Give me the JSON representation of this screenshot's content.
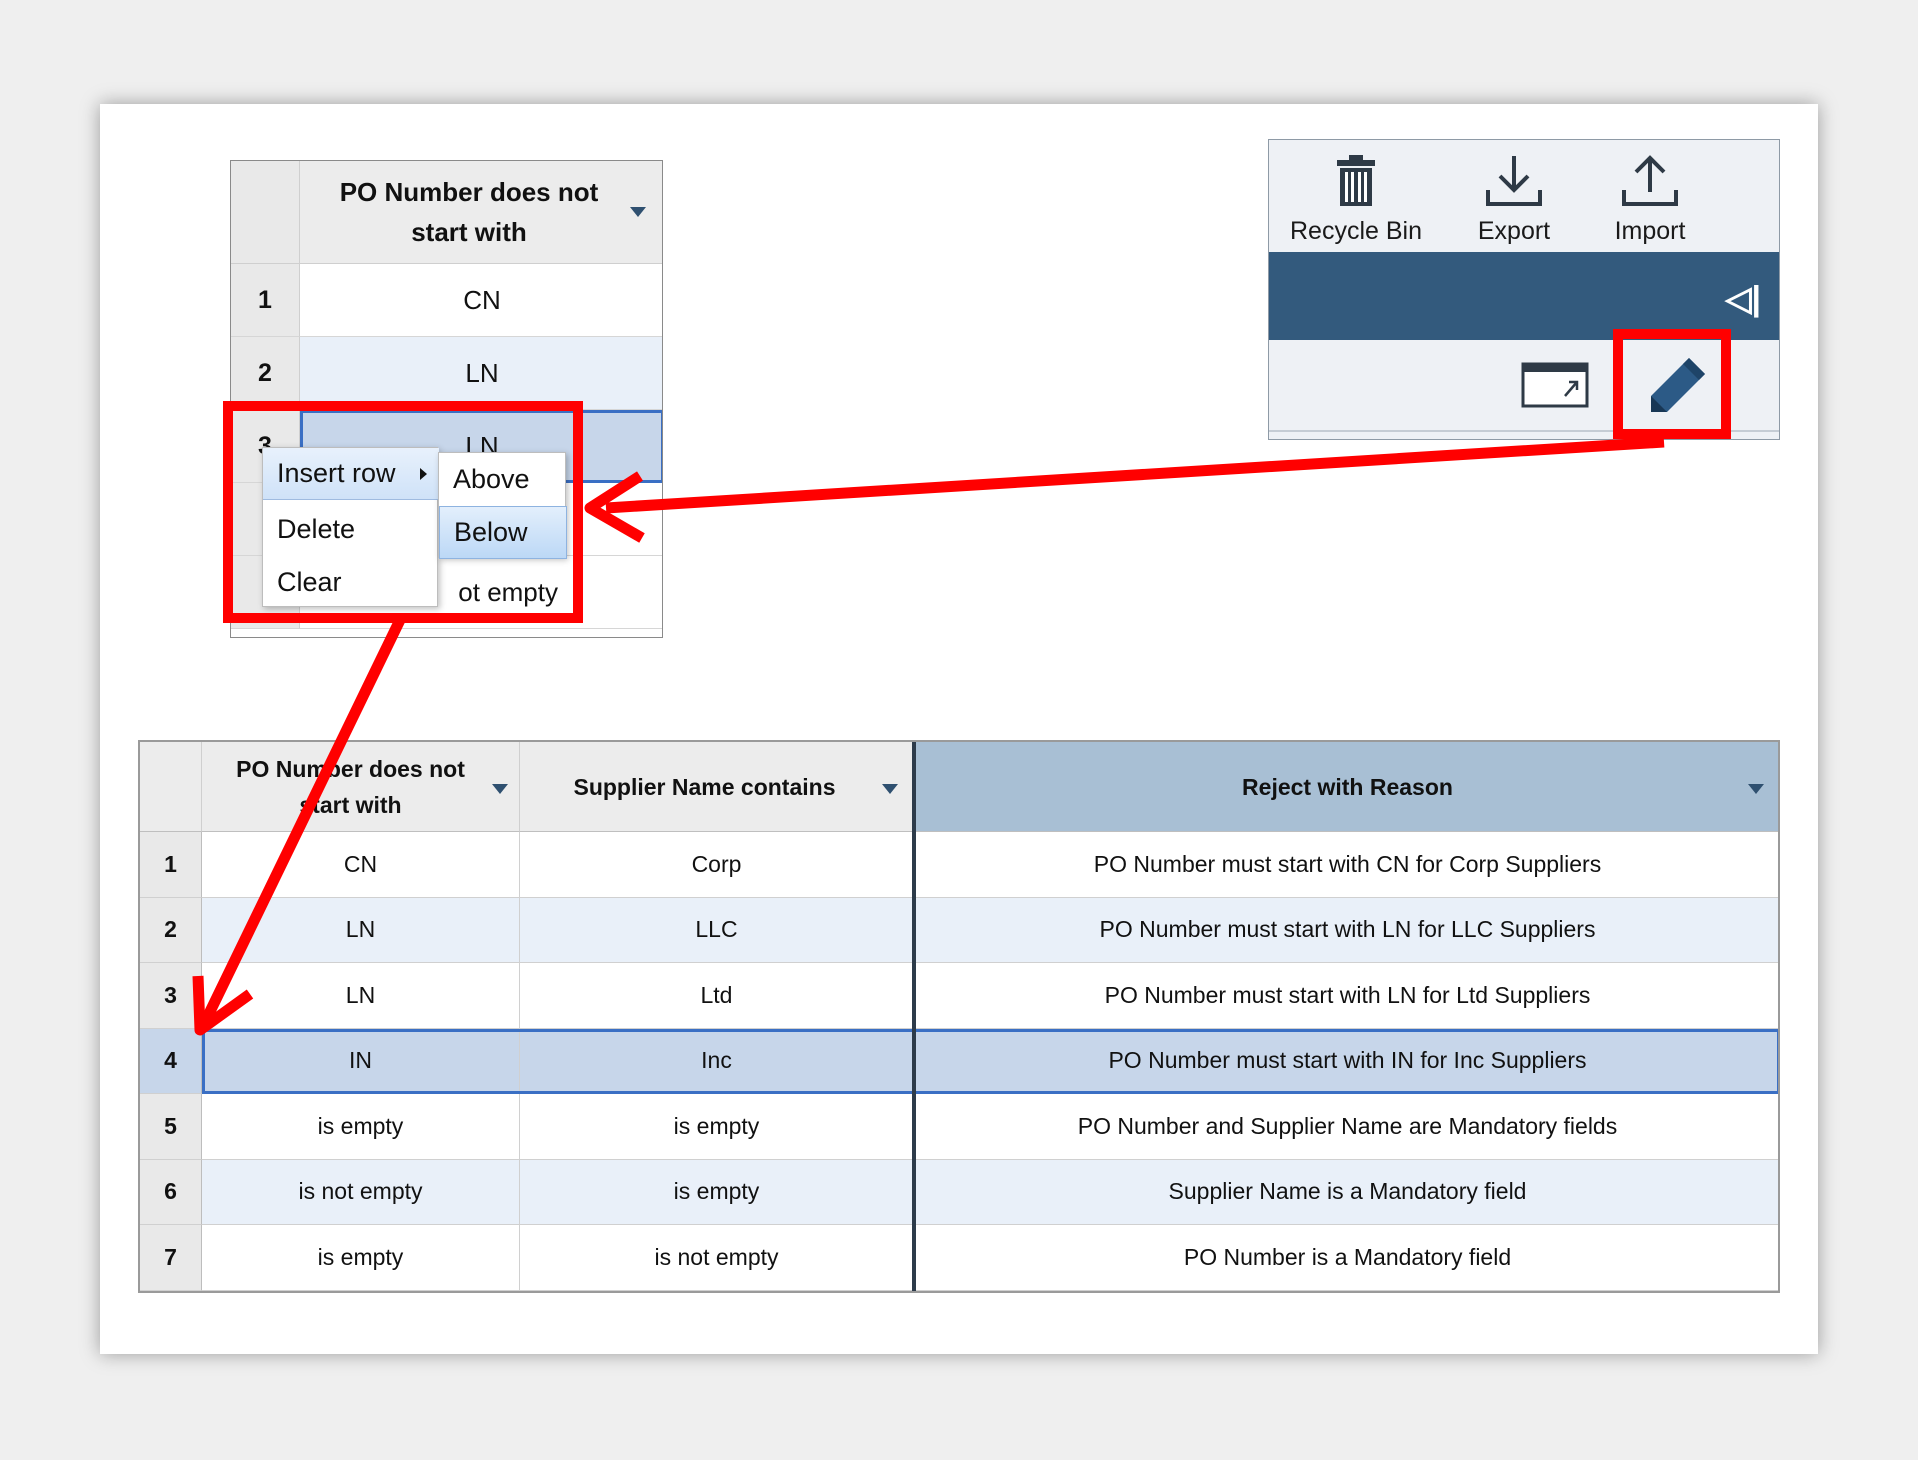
{
  "mini_grid": {
    "header": "PO Number does not start with",
    "rows": [
      {
        "num": "1",
        "value": "CN"
      },
      {
        "num": "2",
        "value": "LN"
      },
      {
        "num": "3",
        "value": "LN"
      }
    ],
    "partial_value": "ot empty"
  },
  "context_menu": {
    "items": [
      "Insert row",
      "Delete",
      "Clear"
    ],
    "submenu": [
      "Above",
      "Below"
    ]
  },
  "toolbar": {
    "recycle_label": "Recycle Bin",
    "export_label": "Export",
    "import_label": "Import"
  },
  "grid": {
    "headers": [
      "PO Number does not start with",
      "Supplier Name contains",
      "Reject with Reason"
    ],
    "rows": [
      {
        "num": "1",
        "po": "CN",
        "supplier": "Corp",
        "reason": "PO Number must start with CN for Corp Suppliers"
      },
      {
        "num": "2",
        "po": "LN",
        "supplier": "LLC",
        "reason": "PO Number must start with LN for LLC Suppliers"
      },
      {
        "num": "3",
        "po": "LN",
        "supplier": "Ltd",
        "reason": "PO Number must start with LN for Ltd Suppliers"
      },
      {
        "num": "4",
        "po": "IN",
        "supplier": "Inc",
        "reason": "PO Number must start with IN for Inc Suppliers"
      },
      {
        "num": "5",
        "po": "is empty",
        "supplier": "is empty",
        "reason": "PO Number and Supplier Name are Mandatory fields"
      },
      {
        "num": "6",
        "po": "is not empty",
        "supplier": "is empty",
        "reason": "Supplier Name is a Mandatory field"
      },
      {
        "num": "7",
        "po": "is empty",
        "supplier": "is not empty",
        "reason": "PO Number is a Mandatory field"
      }
    ],
    "selected_row": 4
  },
  "colors": {
    "annotation_red": "#ff0000",
    "header_blue": "#335a7d",
    "selection_blue": "#3a6fc4",
    "row_alt": "#e9f0f9"
  }
}
